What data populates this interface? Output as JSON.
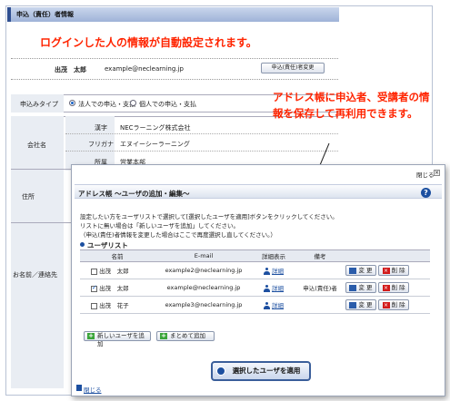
{
  "background_page": {
    "section_title": "申込（責任）者情報",
    "annotation_auto": "ログインした人の情報が自動設定されます。",
    "applicant": {
      "name": "出茂　太郎",
      "email": "example@neclearning.jp",
      "change_button": "申込(責任)者変更"
    },
    "type_label": "申込みタイプ",
    "type_options": [
      {
        "label": "法人での申込・支払",
        "selected": true
      },
      {
        "label": "個人での申込・支払",
        "selected": false
      }
    ],
    "company_label": "会社名",
    "company_fields": [
      {
        "label": "漢字",
        "value": "NECラーニング株式会社"
      },
      {
        "label": "フリガナ",
        "value": "エヌイーシーラーニング"
      },
      {
        "label": "所属",
        "value": "営業本部"
      }
    ],
    "address_label": "住所",
    "contact_label": "お名前／連絡先",
    "annotation_addressbook": "アドレス帳に申込者、受講者の情報を保存して再利用できます。"
  },
  "dialog": {
    "close_top": "閉じる",
    "title": "アドレス帳 ～ユーザの追加・編集～",
    "help": "?",
    "instructions": [
      "設定したい方をユーザリストで選択して[選択したユーザを適用]ボタンをクリックしてください。",
      "リストに無い場合は「新しいユーザを追加」してください。",
      "（申込(責任)者情報を変更した場合はここで再度選択し直してください。）"
    ],
    "userlist_title": "ユーザリスト",
    "columns": [
      "名前",
      "E-mail",
      "詳細表示",
      "備考"
    ],
    "users": [
      {
        "checked": false,
        "name": "出茂　太郎",
        "email": "example2@neclearning.jp",
        "detail": "詳細",
        "note": ""
      },
      {
        "checked": true,
        "name": "出茂　太郎",
        "email": "example@neclearning.jp",
        "detail": "詳細",
        "note": "申込(責任)者"
      },
      {
        "checked": false,
        "name": "出茂　花子",
        "email": "example3@neclearning.jp",
        "detail": "詳細",
        "note": ""
      }
    ],
    "edit_label": "変 更",
    "delete_label": "削 除",
    "add_user_button": "新しいユーザを追加",
    "bulk_add_button": "まとめて追加",
    "apply_button": "選択したユーザを適用",
    "close_bottom": "閉じる"
  },
  "colors": {
    "annotation": "#ff2400",
    "accent": "#1c4fa0",
    "header": "#2f4f91"
  }
}
